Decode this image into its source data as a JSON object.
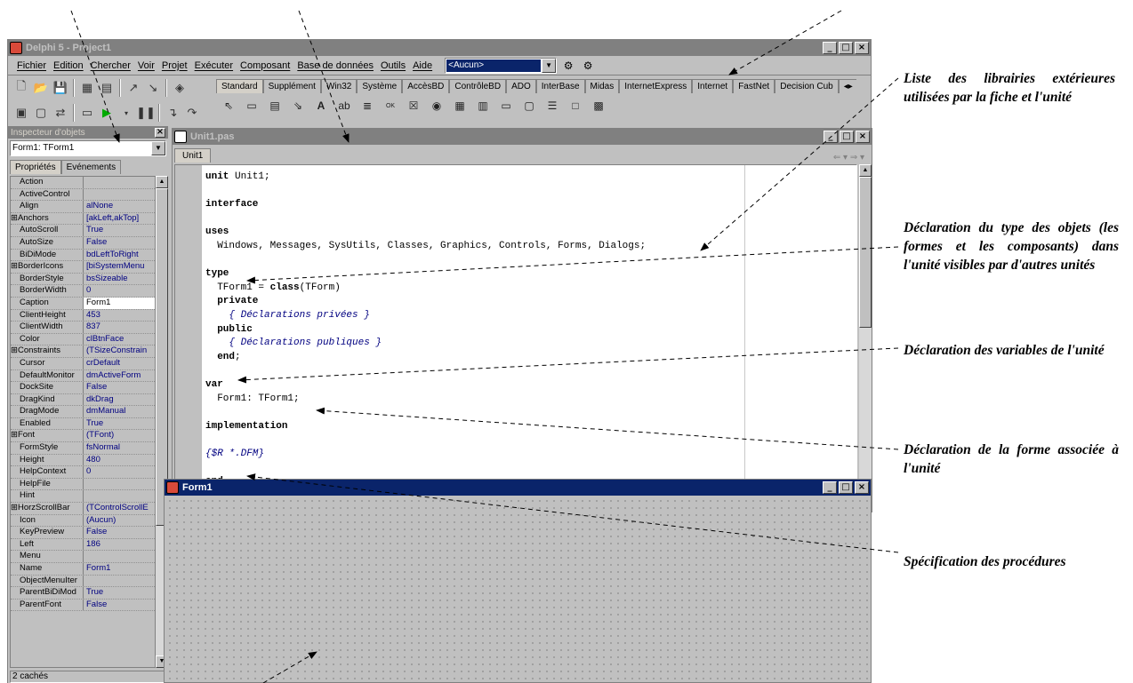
{
  "ide": {
    "title": "Delphi 5 - Project1",
    "menu": [
      "Fichier",
      "Edition",
      "Chercher",
      "Voir",
      "Projet",
      "Exécuter",
      "Composant",
      "Base de données",
      "Outils",
      "Aide"
    ],
    "config_combo": "<Aucun>",
    "palette_tabs": [
      "Standard",
      "Supplément",
      "Win32",
      "Système",
      "AccèsBD",
      "ContrôleBD",
      "ADO",
      "InterBase",
      "Midas",
      "InternetExpress",
      "Internet",
      "FastNet",
      "Decision Cub"
    ]
  },
  "inspector": {
    "title": "Inspecteur d'objets",
    "object": "Form1: TForm1",
    "tabs": [
      "Propriétés",
      "Evénements"
    ],
    "rows": [
      {
        "name": "Action",
        "value": ""
      },
      {
        "name": "ActiveControl",
        "value": ""
      },
      {
        "name": "Align",
        "value": "alNone"
      },
      {
        "name": "⊞Anchors",
        "value": "[akLeft,akTop]"
      },
      {
        "name": "AutoScroll",
        "value": "True"
      },
      {
        "name": "AutoSize",
        "value": "False"
      },
      {
        "name": "BiDiMode",
        "value": "bdLeftToRight"
      },
      {
        "name": "⊞BorderIcons",
        "value": "[biSystemMenu"
      },
      {
        "name": "BorderStyle",
        "value": "bsSizeable"
      },
      {
        "name": "BorderWidth",
        "value": "0"
      },
      {
        "name": "Caption",
        "value": "Form1"
      },
      {
        "name": "ClientHeight",
        "value": "453"
      },
      {
        "name": "ClientWidth",
        "value": "837"
      },
      {
        "name": "Color",
        "value": "clBtnFace"
      },
      {
        "name": "⊞Constraints",
        "value": "(TSizeConstrain"
      },
      {
        "name": "Cursor",
        "value": "crDefault"
      },
      {
        "name": "DefaultMonitor",
        "value": "dmActiveForm"
      },
      {
        "name": "DockSite",
        "value": "False"
      },
      {
        "name": "DragKind",
        "value": "dkDrag"
      },
      {
        "name": "DragMode",
        "value": "dmManual"
      },
      {
        "name": "Enabled",
        "value": "True"
      },
      {
        "name": "⊞Font",
        "value": "(TFont)"
      },
      {
        "name": "FormStyle",
        "value": "fsNormal"
      },
      {
        "name": "Height",
        "value": "480"
      },
      {
        "name": "HelpContext",
        "value": "0"
      },
      {
        "name": "HelpFile",
        "value": ""
      },
      {
        "name": "Hint",
        "value": ""
      },
      {
        "name": "⊞HorzScrollBar",
        "value": "(TControlScrollE"
      },
      {
        "name": "Icon",
        "value": "(Aucun)"
      },
      {
        "name": "KeyPreview",
        "value": "False"
      },
      {
        "name": "Left",
        "value": "186"
      },
      {
        "name": "Menu",
        "value": ""
      },
      {
        "name": "Name",
        "value": "Form1"
      },
      {
        "name": "ObjectMenuIter",
        "value": ""
      },
      {
        "name": "ParentBiDiMod",
        "value": "True"
      },
      {
        "name": "ParentFont",
        "value": "False"
      }
    ],
    "status": "2 cachés"
  },
  "editor": {
    "title": "Unit1.pas",
    "tab": "Unit1",
    "nav": "⇐ ▾ ⇒ ▾",
    "code": [
      {
        "k": "unit",
        "t": " Unit1;"
      },
      {
        "t": ""
      },
      {
        "k": "interface",
        "t": ""
      },
      {
        "t": ""
      },
      {
        "k": "uses",
        "t": ""
      },
      {
        "t": "  Windows, Messages, SysUtils, Classes, Graphics, Controls, Forms, Dialogs;"
      },
      {
        "t": ""
      },
      {
        "k": "type",
        "t": ""
      },
      {
        "t": "  TForm1 = ",
        "k2": "class",
        "t2": "(TForm)"
      },
      {
        "i": "  ",
        "k": "private",
        "t": ""
      },
      {
        "c": "    { Déclarations privées }"
      },
      {
        "i": "  ",
        "k": "public",
        "t": ""
      },
      {
        "c": "    { Déclarations publiques }"
      },
      {
        "i": "  ",
        "k": "end",
        "t": ";"
      },
      {
        "t": ""
      },
      {
        "k": "var",
        "t": ""
      },
      {
        "t": "  Form1: TForm1;"
      },
      {
        "t": ""
      },
      {
        "k": "implementation",
        "t": ""
      },
      {
        "t": ""
      },
      {
        "c": "{$R *.DFM}"
      },
      {
        "t": ""
      },
      {
        "k": "end",
        "t": "."
      }
    ]
  },
  "form": {
    "title": "Form1"
  },
  "annotations": {
    "libs": "Liste des librairies extérieures utilisées par la fiche et l'unité",
    "types": "Déclaration du type des objets (les formes et les composants) dans l'unité visibles par d'autres unités",
    "vars": "Déclaration des variables de l'unité",
    "form": "Déclaration de la forme associée à l'unité",
    "procs": "Spécification des procédures"
  }
}
